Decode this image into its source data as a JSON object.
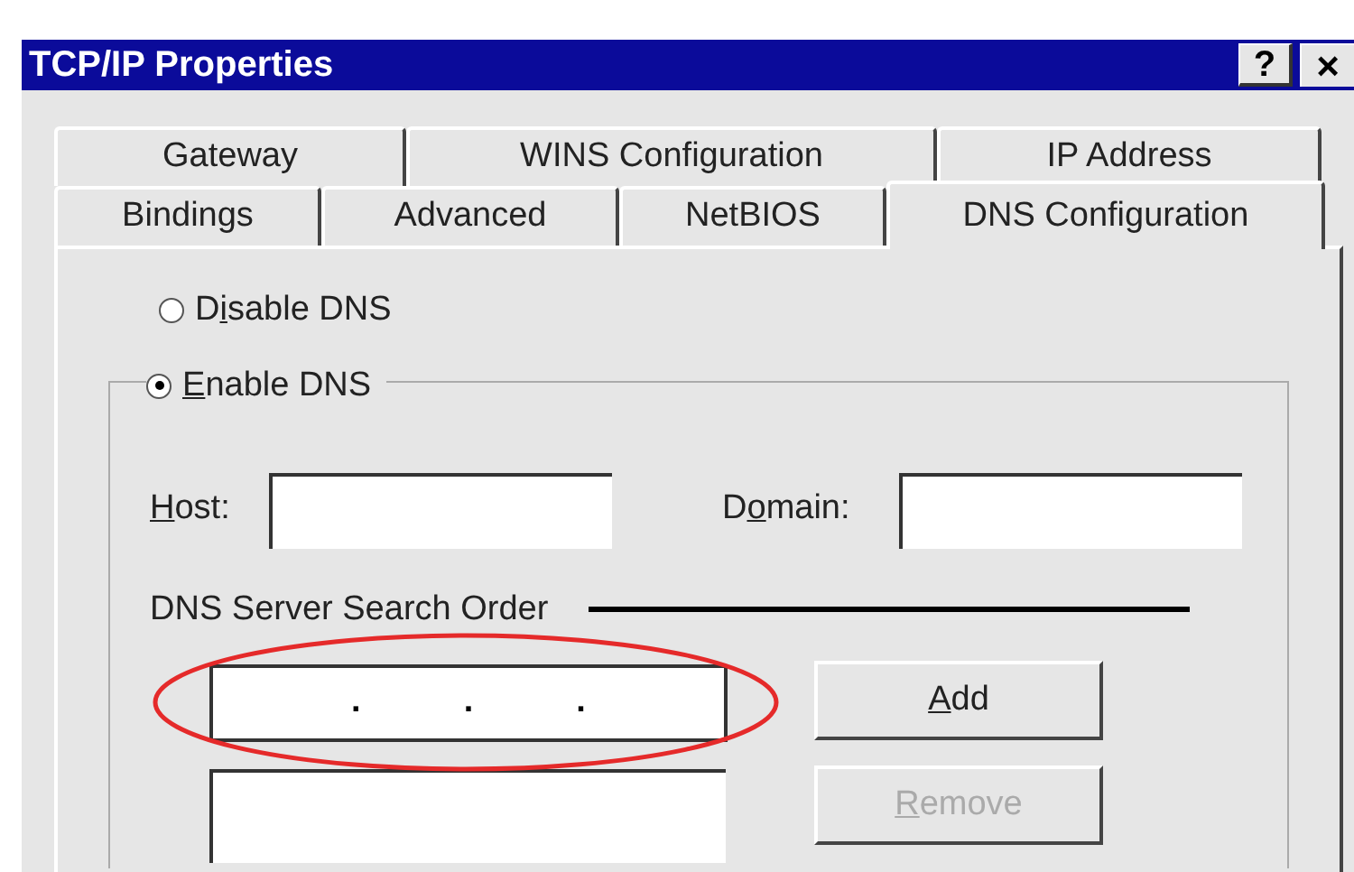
{
  "window": {
    "title": "TCP/IP Properties",
    "help_button": "?",
    "close_button": "×"
  },
  "tabs": [
    [
      {
        "label": "Gateway",
        "selected": false
      },
      {
        "label": "WINS Configuration",
        "selected": false
      },
      {
        "label": "IP Address",
        "selected": false
      }
    ],
    [
      {
        "label": "Bindings",
        "selected": false
      },
      {
        "label": "Advanced",
        "selected": false
      },
      {
        "label": "NetBIOS",
        "selected": false
      },
      {
        "label": "DNS Configuration",
        "selected": true
      }
    ]
  ],
  "dns_mode": [
    {
      "label": {
        "pre": "D",
        "key": "i",
        "post": "sable DNS"
      },
      "selected": false
    },
    {
      "label": {
        "key": "E",
        "post": "nable DNS"
      },
      "selected": true
    }
  ],
  "host": {
    "label": {
      "key": "H",
      "post": "ost:"
    }
  },
  "domain": {
    "label": {
      "pre": "D",
      "key": "o",
      "post": "main:"
    }
  },
  "search_order": {
    "heading": "DNS Server Search Order",
    "ip_separators": [
      ".",
      ".",
      "."
    ],
    "add_button": {
      "label": {
        "key": "A",
        "post": "dd"
      },
      "disabled": false
    },
    "remove_button": {
      "label": {
        "key": "R",
        "post": "emove"
      },
      "disabled": true
    }
  }
}
